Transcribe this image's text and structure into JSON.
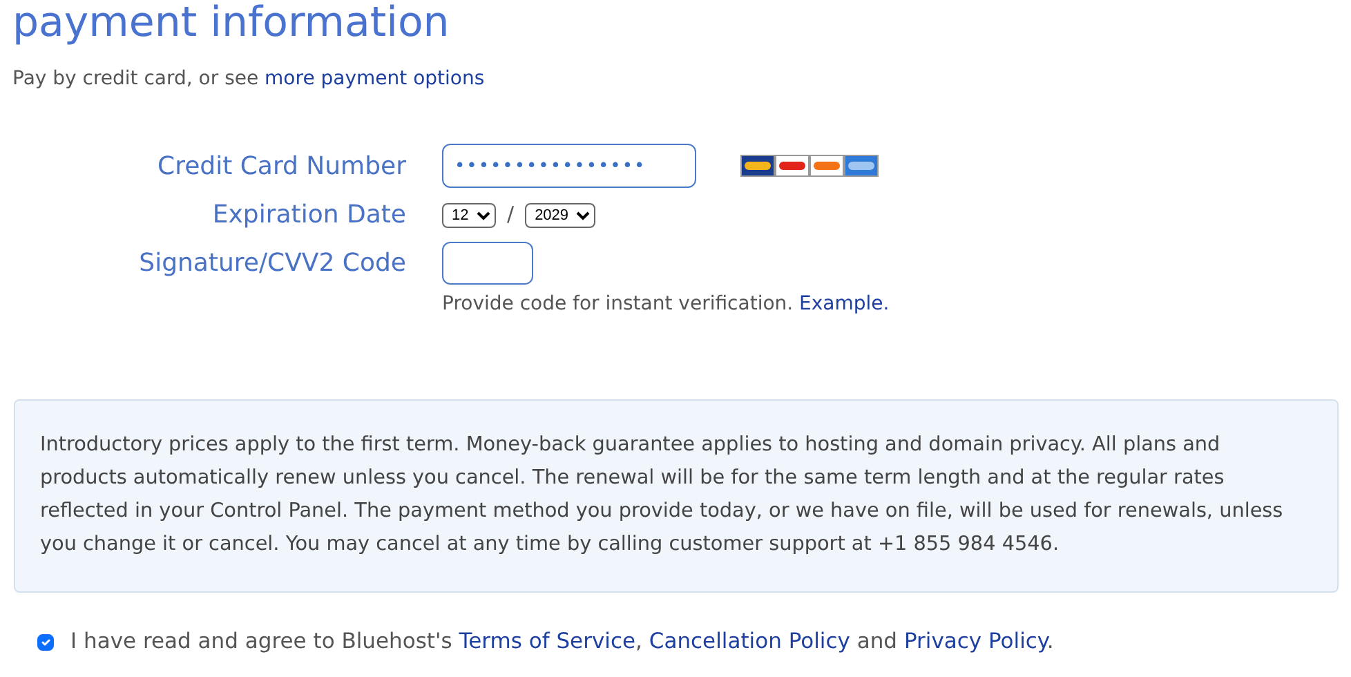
{
  "title": "payment information",
  "intro": {
    "text": "Pay by credit card, or see",
    "link": "more payment options"
  },
  "fields": [
    {
      "kind": "card",
      "label": "Credit Card Number",
      "value": "••••••••••••••••"
    },
    {
      "kind": "expiry",
      "label": "Expiration Date",
      "month": "12",
      "separator": "/",
      "year": "2029"
    },
    {
      "kind": "cvv",
      "label": "Signature/CVV2 Code",
      "help": "Provide code for instant verification.",
      "help_link": "Example."
    }
  ],
  "notice": "Introductory prices apply to the first term. Money-back guarantee applies to hosting and domain privacy. All plans and products automatically renew unless you cancel. The renewal will be for the same term length and at the regular rates reflected in your Control Panel. The payment method you provide today, or we have on file, will be used for renewals, unless you change it or cancel. You may cancel at any time by calling customer support at +1 855 984 4546.",
  "agree": {
    "checked": true,
    "parts": [
      {
        "kind": "text",
        "text": "I have read and agree to Bluehost's"
      },
      {
        "kind": "link",
        "text": "Terms of Service"
      },
      {
        "kind": "text",
        "text": ","
      },
      {
        "kind": "link",
        "text": "Cancellation Policy"
      },
      {
        "kind": "text",
        "text": "and"
      },
      {
        "kind": "link",
        "text": "Privacy Policy"
      },
      {
        "kind": "text",
        "text": "."
      }
    ]
  }
}
